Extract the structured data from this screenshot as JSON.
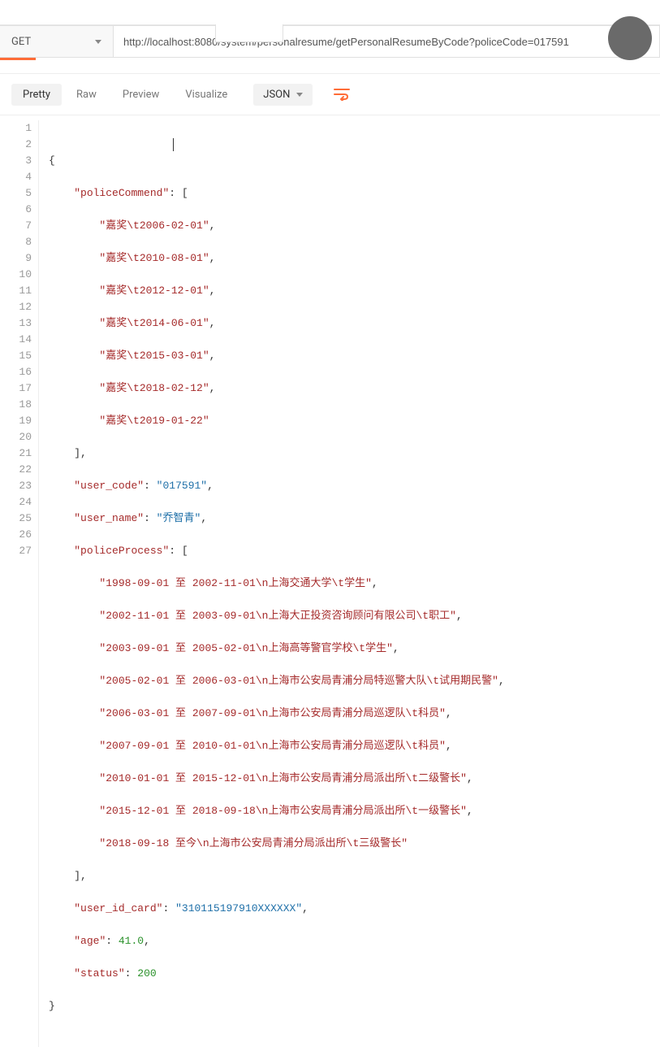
{
  "request": {
    "method": "GET",
    "url": "http://localhost:8080/system/personalresume/getPersonalResumeByCode?policeCode=017591"
  },
  "avatar": {
    "present": true
  },
  "tabs": {
    "pretty": "Pretty",
    "raw": "Raw",
    "preview": "Preview",
    "visualize": "Visualize",
    "active": "pretty"
  },
  "format": {
    "label": "JSON"
  },
  "wrap_button": {
    "name": "toggle-wrap"
  },
  "gutter": [
    "1",
    "2",
    "3",
    "4",
    "5",
    "6",
    "7",
    "8",
    "9",
    "10",
    "11",
    "12",
    "13",
    "14",
    "15",
    "16",
    "17",
    "18",
    "19",
    "20",
    "21",
    "22",
    "23",
    "24",
    "25",
    "26",
    "27"
  ],
  "json_body": {
    "keys": {
      "policeCommend": "policeCommend",
      "user_code": "user_code",
      "user_name": "user_name",
      "policeProcess": "policeProcess",
      "user_id_card": "user_id_card",
      "age": "age",
      "status": "status"
    },
    "policeCommend": [
      "嘉奖\\t2006-02-01",
      "嘉奖\\t2010-08-01",
      "嘉奖\\t2012-12-01",
      "嘉奖\\t2014-06-01",
      "嘉奖\\t2015-03-01",
      "嘉奖\\t2018-02-12",
      "嘉奖\\t2019-01-22"
    ],
    "user_code": "017591",
    "user_name": "乔智青",
    "policeProcess": [
      "1998-09-01 至 2002-11-01\\n上海交通大学\\t学生",
      "2002-11-01 至 2003-09-01\\n上海大正投资咨询顾问有限公司\\t职工",
      "2003-09-01 至 2005-02-01\\n上海高等警官学校\\t学生",
      "2005-02-01 至 2006-03-01\\n上海市公安局青浦分局特巡警大队\\t试用期民警",
      "2006-03-01 至 2007-09-01\\n上海市公安局青浦分局巡逻队\\t科员",
      "2007-09-01 至 2010-01-01\\n上海市公安局青浦分局巡逻队\\t科员",
      "2010-01-01 至 2015-12-01\\n上海市公安局青浦分局派出所\\t二级警长",
      "2015-12-01 至 2018-09-18\\n上海市公安局青浦分局派出所\\t一级警长",
      "2018-09-18 至今\\n上海市公安局青浦分局派出所\\t三级警长"
    ],
    "user_id_card": "310115197910XXXXXX",
    "age": "41.0",
    "status": "200"
  }
}
